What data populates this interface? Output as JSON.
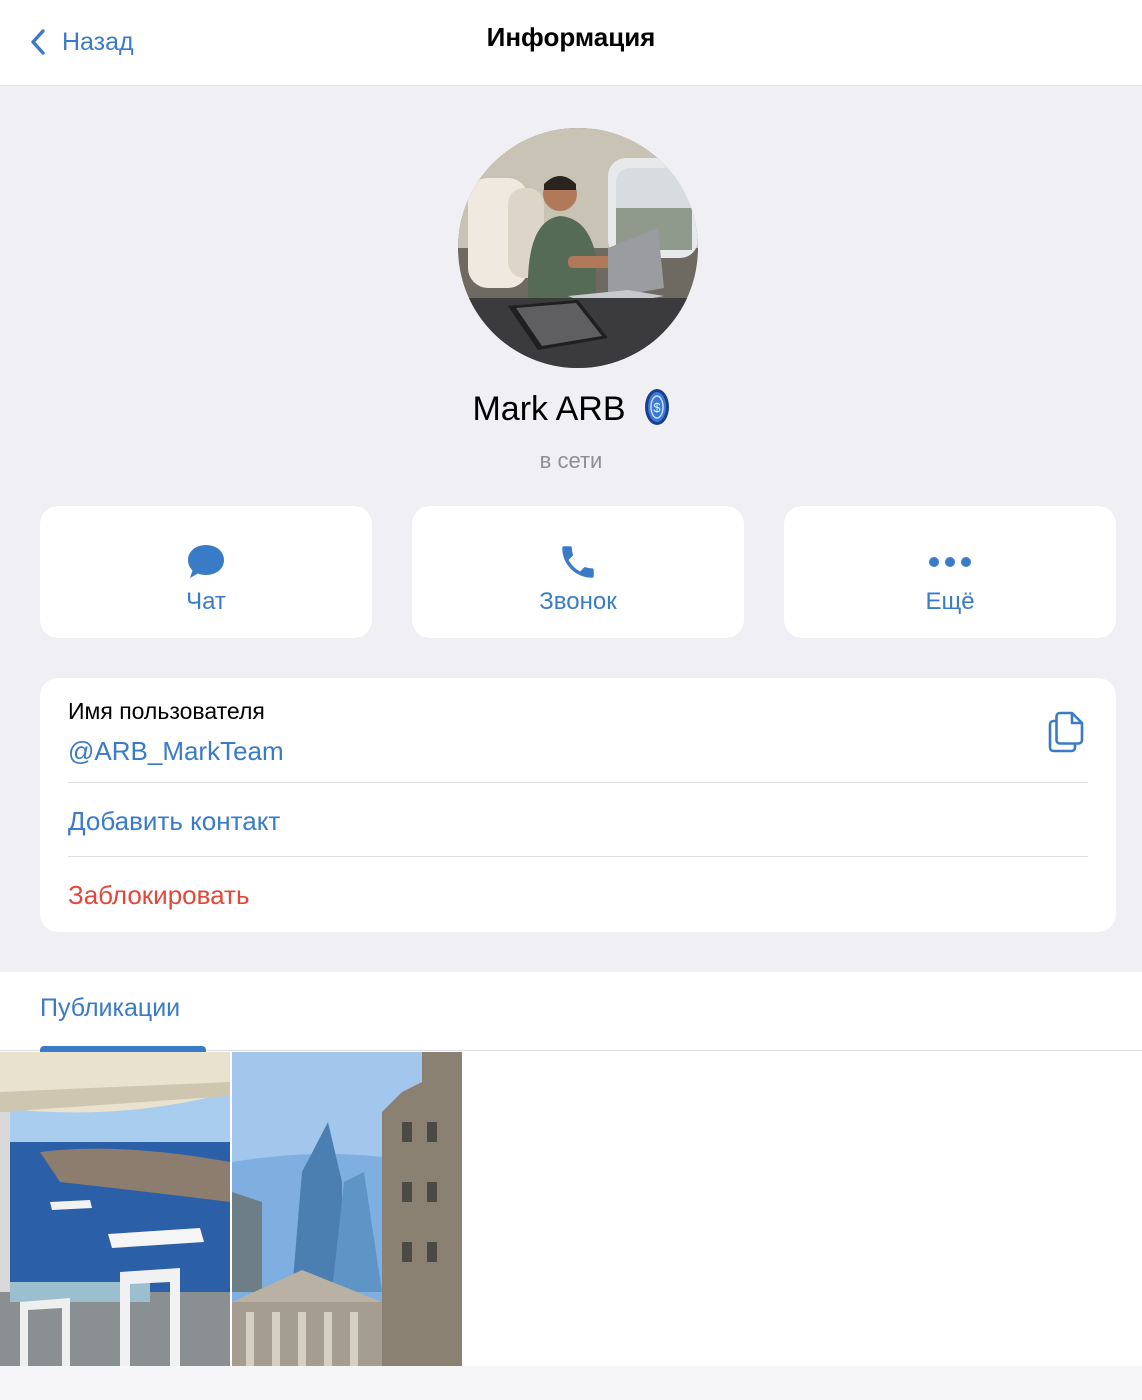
{
  "header": {
    "back_label": "Назад",
    "title": "Информация"
  },
  "profile": {
    "name": "Mark ARB",
    "status": "в сети",
    "badge_icon": "coin-badge-icon"
  },
  "actions": [
    {
      "label": "Чат",
      "icon": "chat-bubble-icon"
    },
    {
      "label": "Звонок",
      "icon": "phone-icon"
    },
    {
      "label": "Ещё",
      "icon": "more-dots-icon"
    }
  ],
  "info": {
    "username_label": "Имя пользователя",
    "username_value": "@ARB_MarkTeam",
    "add_contact": "Добавить контакт",
    "block": "Заблокировать"
  },
  "publications": {
    "tab_label": "Публикации"
  },
  "colors": {
    "accent": "#3a7bc8",
    "danger": "#e2483a",
    "background": "#efeff4"
  }
}
